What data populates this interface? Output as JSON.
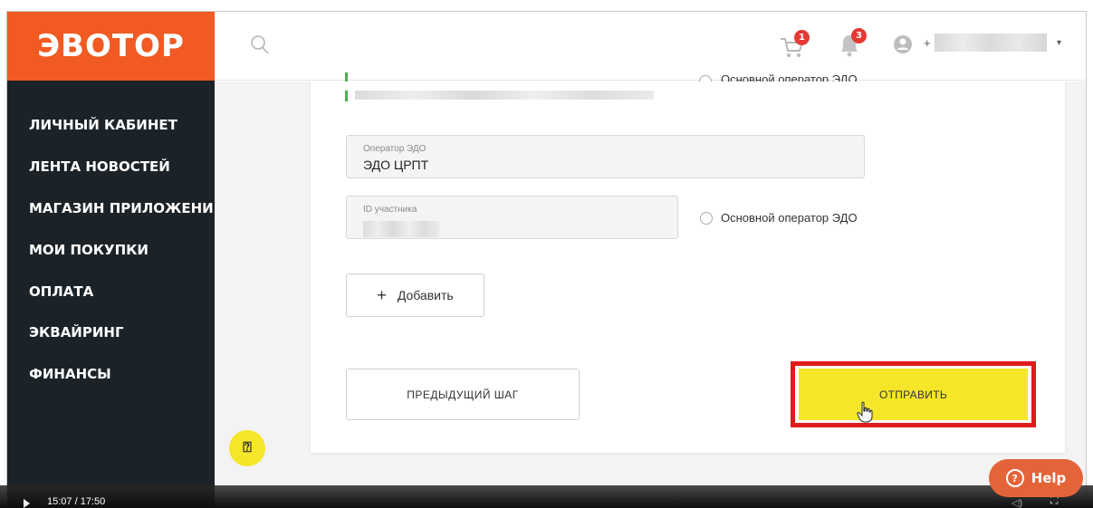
{
  "brand": {
    "logo_text": "ЭВОТОР",
    "color": "#f15a22"
  },
  "sidebar": {
    "items": [
      {
        "label": "ЛИЧНЫЙ КАБИНЕТ"
      },
      {
        "label": "ЛЕНТА НОВОСТЕЙ"
      },
      {
        "label": "МАГАЗИН ПРИЛОЖЕНИЙ"
      },
      {
        "label": "МОИ ПОКУПКИ"
      },
      {
        "label": "ОПЛАТА"
      },
      {
        "label": "ЭКВАЙРИНГ"
      },
      {
        "label": "ФИНАНСЫ"
      }
    ]
  },
  "header": {
    "search_icon": "search-icon",
    "cart_badge": "1",
    "notifications_badge": "3",
    "phone_prefix": "+"
  },
  "form": {
    "top_radio_label": "Основной оператор ЭДО",
    "operator_field": {
      "label": "Оператор ЭДО",
      "value": "ЭДО ЦРПТ"
    },
    "participant_field": {
      "label": "ID участника"
    },
    "participant_radio_label": "Основной оператор ЭДО",
    "add_button": "Добавить",
    "prev_button": "ПРЕДЫДУЩИЙ ШАГ",
    "submit_button": "ОТПРАВИТЬ"
  },
  "help": {
    "label": "Help"
  },
  "video": {
    "time": "15:07 / 17:50"
  },
  "colors": {
    "accent": "#f15a22",
    "sidebar_bg": "#1c2328",
    "submit_bg": "#f5e62a",
    "highlight": "#e01b1b",
    "help_bg": "#e4643a"
  }
}
